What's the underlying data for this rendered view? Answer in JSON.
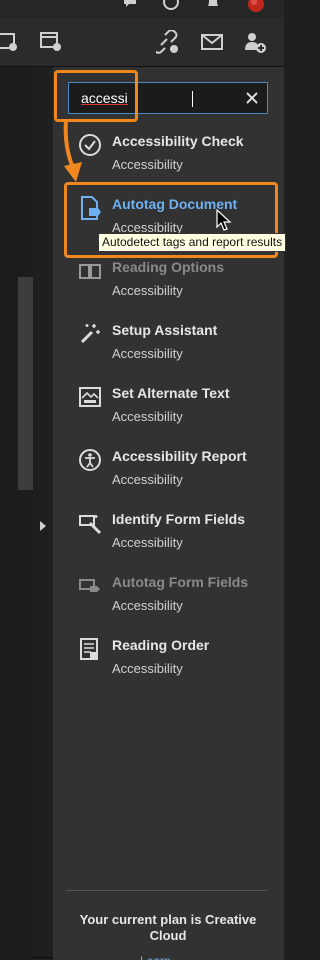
{
  "search": {
    "value": "accessi",
    "placeholder": ""
  },
  "results": [
    {
      "title": "Accessibility Check",
      "subtitle": "Accessibility",
      "icon": "check-circle-icon"
    },
    {
      "title": "Autotag Document",
      "subtitle": "Accessibility",
      "icon": "autotag-document-icon"
    },
    {
      "title": "Reading Options",
      "subtitle": "Accessibility",
      "icon": "reading-options-icon"
    },
    {
      "title": "Setup Assistant",
      "subtitle": "Accessibility",
      "icon": "magic-wand-icon"
    },
    {
      "title": "Set Alternate Text",
      "subtitle": "Accessibility",
      "icon": "alternate-text-icon"
    },
    {
      "title": "Accessibility Report",
      "subtitle": "Accessibility",
      "icon": "accessibility-person-icon"
    },
    {
      "title": "Identify Form Fields",
      "subtitle": "Accessibility",
      "icon": "identify-form-fields-icon"
    },
    {
      "title": "Autotag Form Fields",
      "subtitle": "Accessibility",
      "icon": "autotag-form-fields-icon"
    },
    {
      "title": "Reading Order",
      "subtitle": "Accessibility",
      "icon": "reading-order-icon"
    }
  ],
  "tooltip": "Autodetect tags and report results",
  "plan": {
    "text": "Your current plan is Creative Cloud",
    "more": "Learn More"
  },
  "colors": {
    "accent": "#f0881f",
    "highlight": "#6fb0f2",
    "panel": "#323232"
  }
}
